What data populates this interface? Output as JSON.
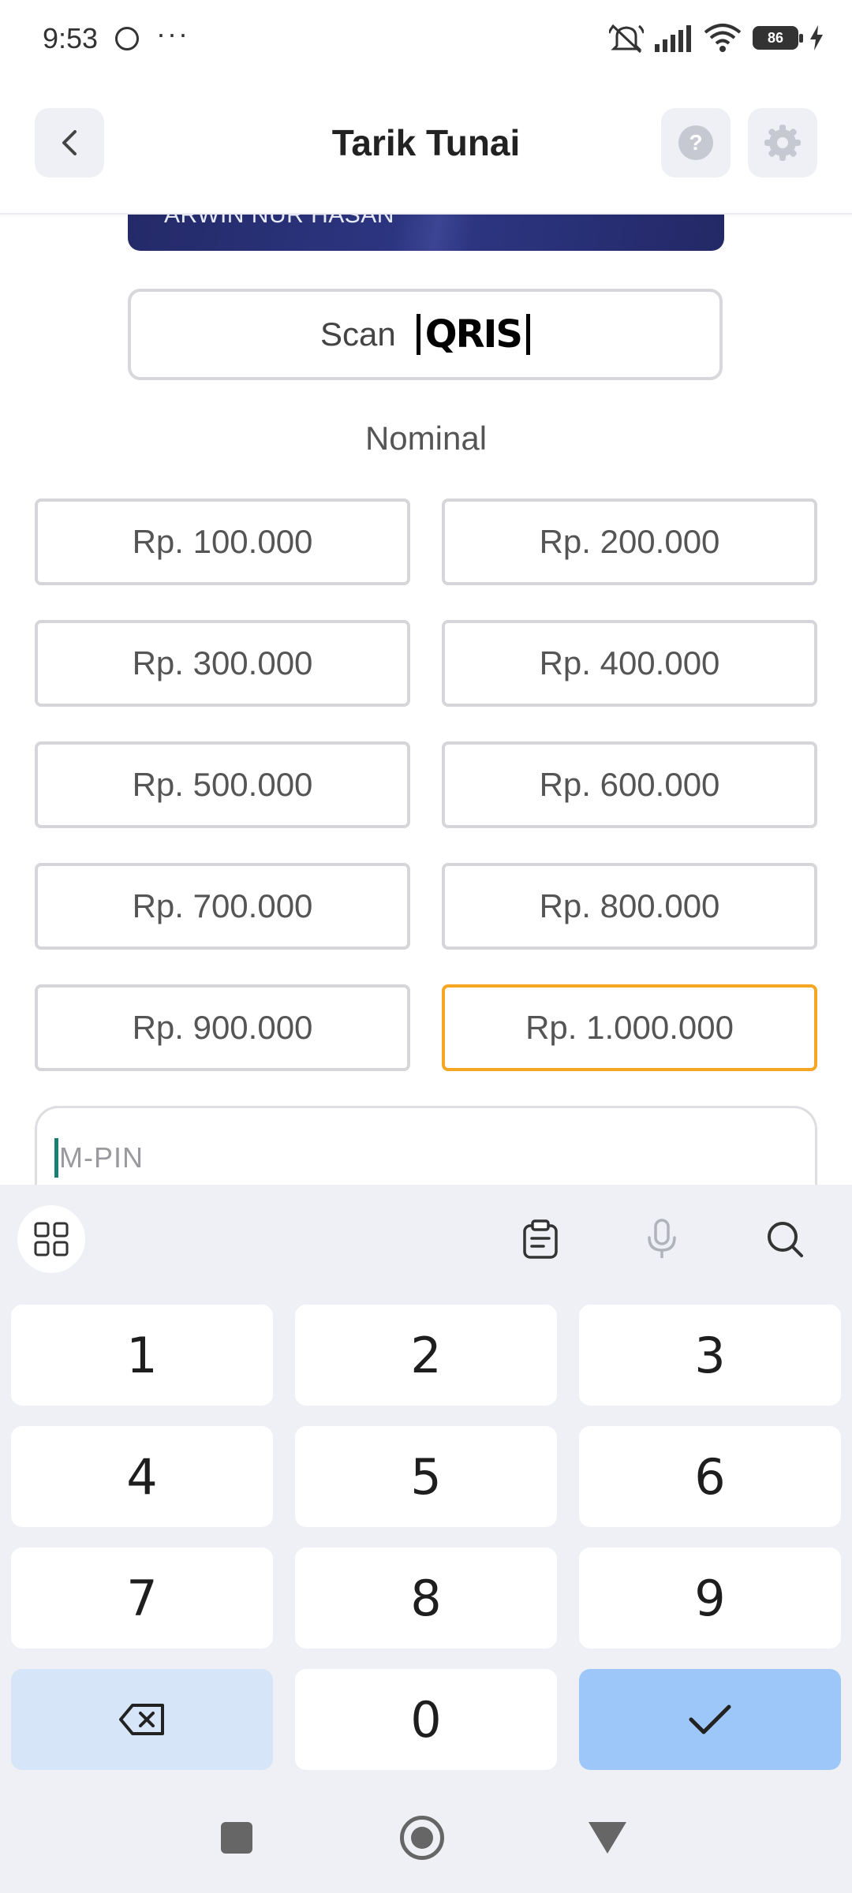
{
  "status_bar": {
    "time": "9:53",
    "dots": "···",
    "battery": "86"
  },
  "header": {
    "title": "Tarik Tunai",
    "help_label": "?"
  },
  "card": {
    "holder_name": "ARWIN NUR HASAN"
  },
  "scan": {
    "label": "Scan",
    "logo_text": "QRIS"
  },
  "nominal": {
    "label": "Nominal",
    "options": [
      "Rp. 100.000",
      "Rp. 200.000",
      "Rp. 300.000",
      "Rp. 400.000",
      "Rp. 500.000",
      "Rp. 600.000",
      "Rp. 700.000",
      "Rp. 800.000",
      "Rp. 900.000",
      "Rp. 1.000.000"
    ],
    "selected": "Rp. 1.000.000"
  },
  "pin": {
    "placeholder": "M-PIN",
    "value": ""
  },
  "keyboard": {
    "keys": [
      "1",
      "2",
      "3",
      "4",
      "5",
      "6",
      "7",
      "8",
      "9",
      "0"
    ]
  },
  "colors": {
    "accent_selected": "#f5a623",
    "card_blue": "#2c3580",
    "confirm_key": "#9cc7f8"
  }
}
